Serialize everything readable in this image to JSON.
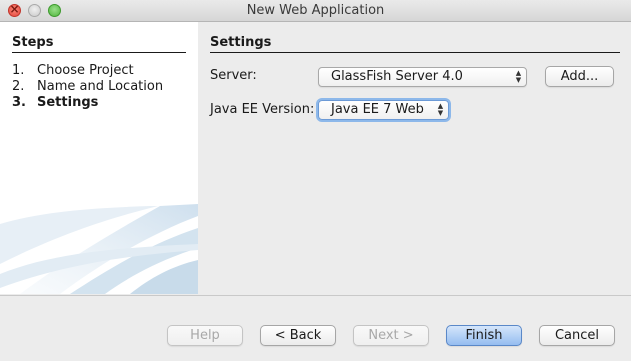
{
  "window": {
    "title": "New Web Application"
  },
  "steps": {
    "heading": "Steps",
    "items": [
      {
        "num": "1.",
        "label": "Choose Project"
      },
      {
        "num": "2.",
        "label": "Name and Location"
      },
      {
        "num": "3.",
        "label": "Settings"
      }
    ],
    "current_index": 2
  },
  "settings": {
    "heading": "Settings",
    "server_label": "Server:",
    "server_value": "GlassFish Server 4.0",
    "add_button": "Add...",
    "javaee_label": "Java EE Version:",
    "javaee_value": "Java EE 7 Web"
  },
  "footer": {
    "help": "Help",
    "back": "< Back",
    "next": "Next >",
    "finish": "Finish",
    "cancel": "Cancel"
  },
  "colors": {
    "accent": "#95bdf0",
    "focus_ring": "#8db8ea",
    "close": "#e0443a",
    "maximize": "#4fb43c"
  }
}
